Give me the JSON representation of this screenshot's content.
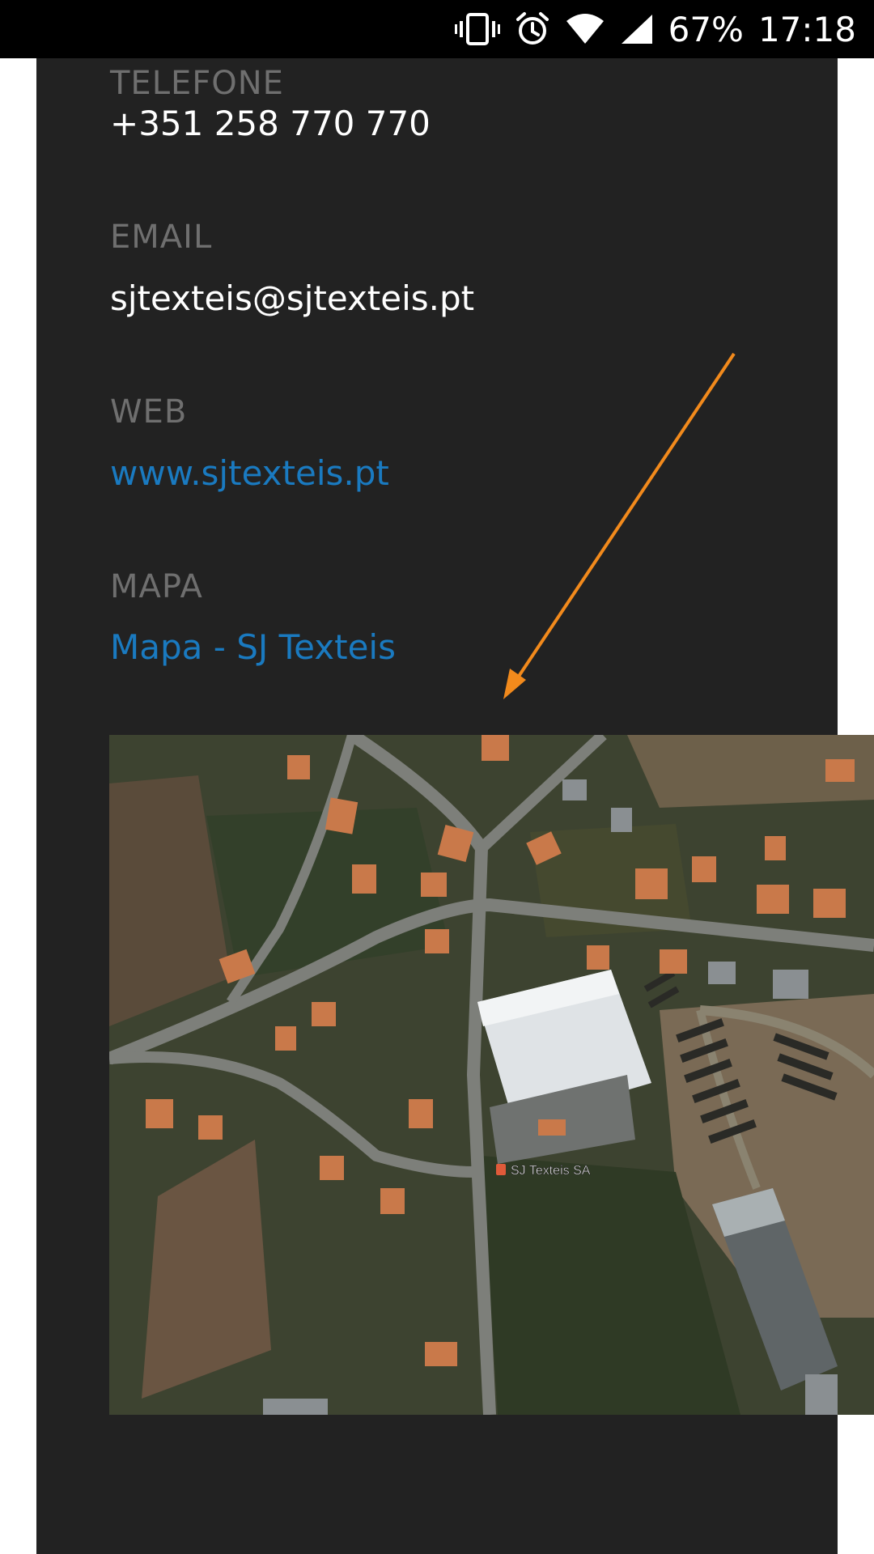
{
  "status_bar": {
    "battery": "67%",
    "time": "17:18",
    "icons": [
      "vibrate-icon",
      "alarm-icon",
      "wifi-icon",
      "cell-signal-icon"
    ]
  },
  "contact": {
    "telefone_label": "TELEFONE",
    "telefone_value": "+351 258 770 770",
    "email_label": "EMAIL",
    "email_value": "sjtexteis@sjtexteis.pt",
    "web_label": "WEB",
    "web_value": "www.sjtexteis.pt",
    "mapa_label": "MAPA",
    "mapa_value": "Mapa - SJ Texteis"
  },
  "map": {
    "marker_label": "SJ Texteis SA"
  },
  "colors": {
    "panel": "#222222",
    "label": "#6f6f6f",
    "link": "#1a7ac0",
    "annotation_arrow": "#f28a1c"
  }
}
